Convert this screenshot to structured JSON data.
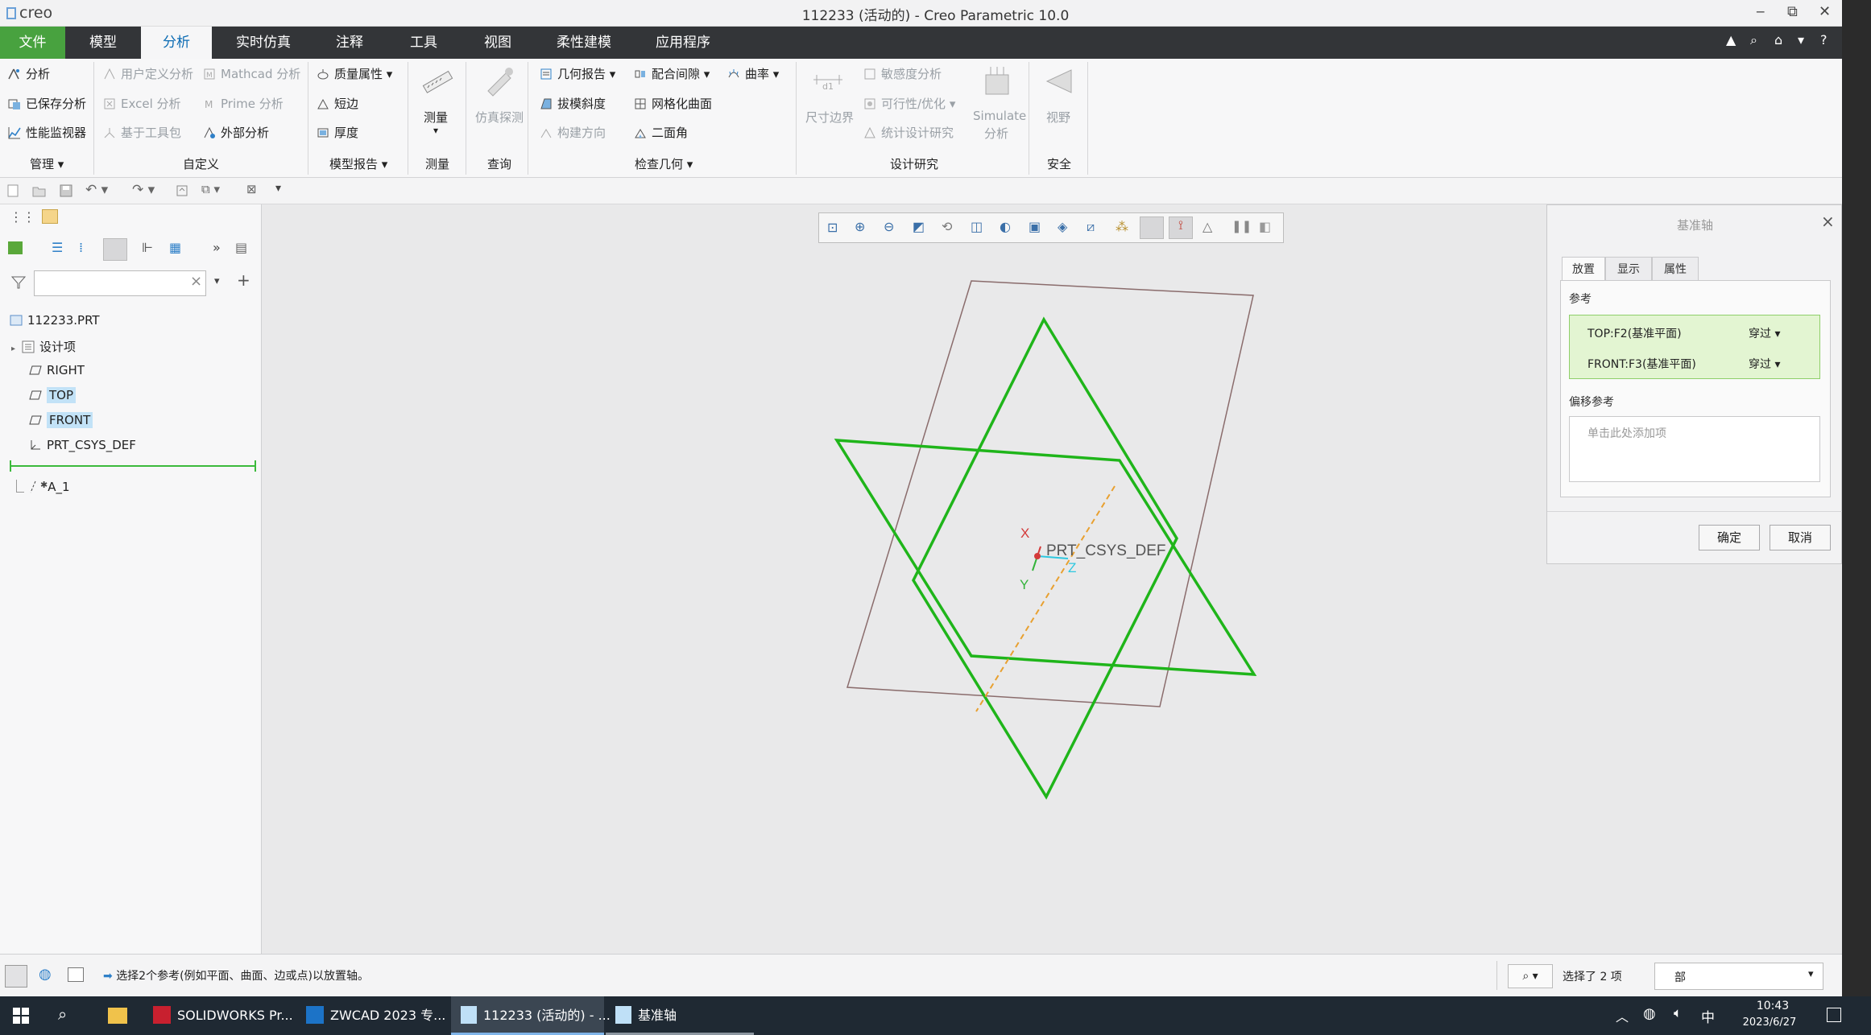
{
  "window": {
    "app_logo": "creo",
    "title": "112233 (活动的) - Creo Parametric 10.0",
    "minimize": "‒",
    "restore": "⧉",
    "close": "✕"
  },
  "menu": {
    "file": "文件",
    "tabs": [
      "模型",
      "分析",
      "实时仿真",
      "注释",
      "工具",
      "视图",
      "柔性建模",
      "应用程序"
    ],
    "active_tab": "分析",
    "right_icons": [
      "▲",
      "⌕",
      "⌂",
      "▾",
      "?"
    ]
  },
  "ribbon": {
    "manage": {
      "items": [
        "分析",
        "已保存分析",
        "性能监视器"
      ],
      "label": "管理 ▾"
    },
    "custom": {
      "items": [
        "用户定义分析",
        "Excel 分析",
        "基于工具包",
        "Mathcad 分析",
        "Prime 分析",
        "外部分析"
      ],
      "label": "自定义"
    },
    "model_report": {
      "items": [
        "质量属性",
        "短边",
        "厚度"
      ],
      "label": "模型报告 ▾"
    },
    "measure": {
      "big": "测量",
      "label": "测量"
    },
    "query": {
      "big": "仿真探测",
      "label": "查询"
    },
    "inspect": {
      "items": [
        "几何报告",
        "拔模斜度",
        "构建方向",
        "配合间隙",
        "网格化曲面",
        "二面角",
        "曲率"
      ],
      "label": "检查几何 ▾"
    },
    "design_study": {
      "big1": "尺寸边界",
      "items": [
        "敏感度分析",
        "可行性/优化",
        "统计设计研究"
      ],
      "big2a": "Simulate",
      "big2b": "分析",
      "label": "设计研究"
    },
    "safety": {
      "big": "视野",
      "label": "安全"
    }
  },
  "tree": {
    "root": "112233.PRT",
    "items": [
      "设计项",
      "RIGHT",
      "TOP",
      "FRONT",
      "PRT_CSYS_DEF"
    ],
    "inserted": "A_1",
    "search_clear": "×"
  },
  "graphics": {
    "csys_label": "PRT_CSYS_DEF",
    "axis_x": "X",
    "axis_y": "Y",
    "axis_z": "Z"
  },
  "dialog": {
    "title": "基准轴",
    "close": "×",
    "tabs": [
      "放置",
      "显示",
      "属性"
    ],
    "ref_label": "参考",
    "refs": [
      {
        "name": "TOP:F2(基准平面)",
        "type": "穿过 ▾"
      },
      {
        "name": "FRONT:F3(基准平面)",
        "type": "穿过 ▾"
      }
    ],
    "offset_label": "偏移参考",
    "offset_placeholder": "单击此处添加项",
    "ok": "确定",
    "cancel": "取消"
  },
  "status": {
    "message": "选择2个参考(例如平面、曲面、边或点)以放置轴。",
    "selected": "选择了 2 项",
    "filter": "部"
  },
  "taskbar": {
    "apps": [
      "SOLIDWORKS Pr...",
      "ZWCAD 2023 专...",
      "112233 (活动的) - ...",
      "基准轴"
    ],
    "active_app": "112233 (活动的) - ...",
    "ime": "中",
    "time": "10:43",
    "date": "2023/6/27"
  },
  "colors": {
    "menubar": "#333538",
    "file_tab": "#48a23f",
    "active_tab_text": "#0b6bb3",
    "plane_green": "#1fb51a",
    "plane_brown": "#7a5a5a",
    "axis_orange": "#e8a030",
    "highlight": "#c2e2f7",
    "ref_box": "#e3f5d2"
  }
}
